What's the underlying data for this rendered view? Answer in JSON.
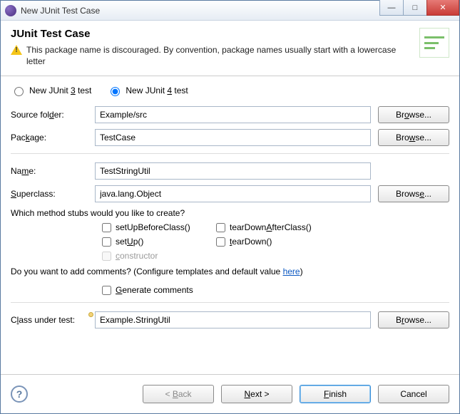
{
  "titlebar": {
    "title": "New JUnit Test Case"
  },
  "banner": {
    "title": "JUnit Test Case",
    "message": "This package name is discouraged. By convention, package names usually start with a lowercase letter"
  },
  "radios": {
    "junit3_pre": "New JUnit ",
    "junit3_u": "3",
    "junit3_post": " test",
    "junit4_pre": "New JUnit ",
    "junit4_u": "4",
    "junit4_post": " test"
  },
  "labels": {
    "source_pre": "Source fol",
    "source_u": "d",
    "source_post": "er:",
    "package_pre": "Pac",
    "package_u": "k",
    "package_post": "age:",
    "name_pre": "Na",
    "name_u": "m",
    "name_post": "e:",
    "super_u": "S",
    "super_post": "uperclass:",
    "cut_pre": "C",
    "cut_u": "l",
    "cut_post": "ass under test:"
  },
  "fields": {
    "source": "Example/src",
    "package": "TestCase",
    "name": "TestStringUtil",
    "superclass": "java.lang.Object",
    "class_under_test": "Example.StringUtil"
  },
  "buttons": {
    "browse1_pre": "Br",
    "browse1_u": "o",
    "browse1_post": "wse...",
    "browse2_pre": "Bro",
    "browse2_u": "w",
    "browse2_post": "se...",
    "browse3_pre": "Brows",
    "browse3_u": "e",
    "browse3_post": "...",
    "browse4_pre": "B",
    "browse4_u": "r",
    "browse4_post": "owse..."
  },
  "stubs": {
    "question": "Which method stubs would you like to create?",
    "setUpBefore_pre": "setUpBeforeClass",
    "setUpBefore_paren": "()",
    "tearDownAfter_pre": "tearDown",
    "tearDownAfter_u": "A",
    "tearDownAfter_post": "fterClass()",
    "setUp_pre": "set",
    "setUp_u": "U",
    "setUp_post": "p()",
    "tearDown_u": "t",
    "tearDown_post": "earDown()",
    "constructor_u": "c",
    "constructor_post": "onstructor"
  },
  "comments": {
    "text": "Do you want to add comments? (Configure templates and default value ",
    "link": "here",
    "tail": ")",
    "generate_u": "G",
    "generate_post": "enerate comments"
  },
  "wizard": {
    "back_pre": "< ",
    "back_u": "B",
    "back_post": "ack",
    "next_u": "N",
    "next_post": "ext >",
    "finish_u": "F",
    "finish_post": "inish",
    "cancel": "Cancel"
  }
}
